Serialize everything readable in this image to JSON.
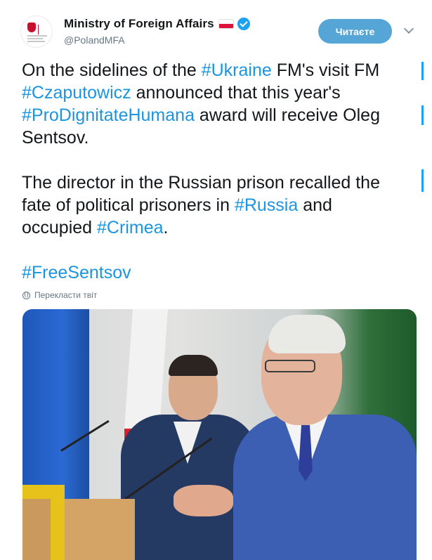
{
  "account": {
    "display_name": "Ministry of Foreign Affairs",
    "handle": "@PolandMFA",
    "flag_icon": "poland-flag-icon",
    "verified_icon": "verified-badge-icon"
  },
  "actions": {
    "follow_label": "Читаєте",
    "menu_icon": "chevron-down-icon"
  },
  "tweet": {
    "paragraphs": [
      [
        [
          {
            "t": "On the sidelines of the "
          },
          {
            "t": "#Ukraine",
            "tag": true
          },
          {
            "t": " FM's visit FM"
          }
        ],
        [
          {
            "t": "#Czaputowicz",
            "tag": true
          },
          {
            "t": " announced that this year's"
          }
        ],
        [
          {
            "t": "#ProDignitateHumana",
            "tag": true
          },
          {
            "t": " award will receive Oleg"
          }
        ],
        [
          {
            "t": "Sentsov."
          }
        ]
      ],
      [
        [
          {
            "t": "The director in the Russian prison recalled the"
          }
        ],
        [
          {
            "t": "fate of political prisoners in "
          },
          {
            "t": "#Russia",
            "tag": true
          },
          {
            "t": " and"
          }
        ],
        [
          {
            "t": "occupied "
          },
          {
            "t": "#Crimea",
            "tag": true
          },
          {
            "t": "."
          }
        ]
      ],
      [
        [
          {
            "t": "#FreeSentsov",
            "tag": true
          }
        ]
      ]
    ]
  },
  "translate": {
    "label": "Перекласти твіт",
    "icon": "globe-icon"
  },
  "colors": {
    "hashtag": "#1b95e0",
    "follow_button": "#55a5d6",
    "verified": "#1da1f2"
  }
}
